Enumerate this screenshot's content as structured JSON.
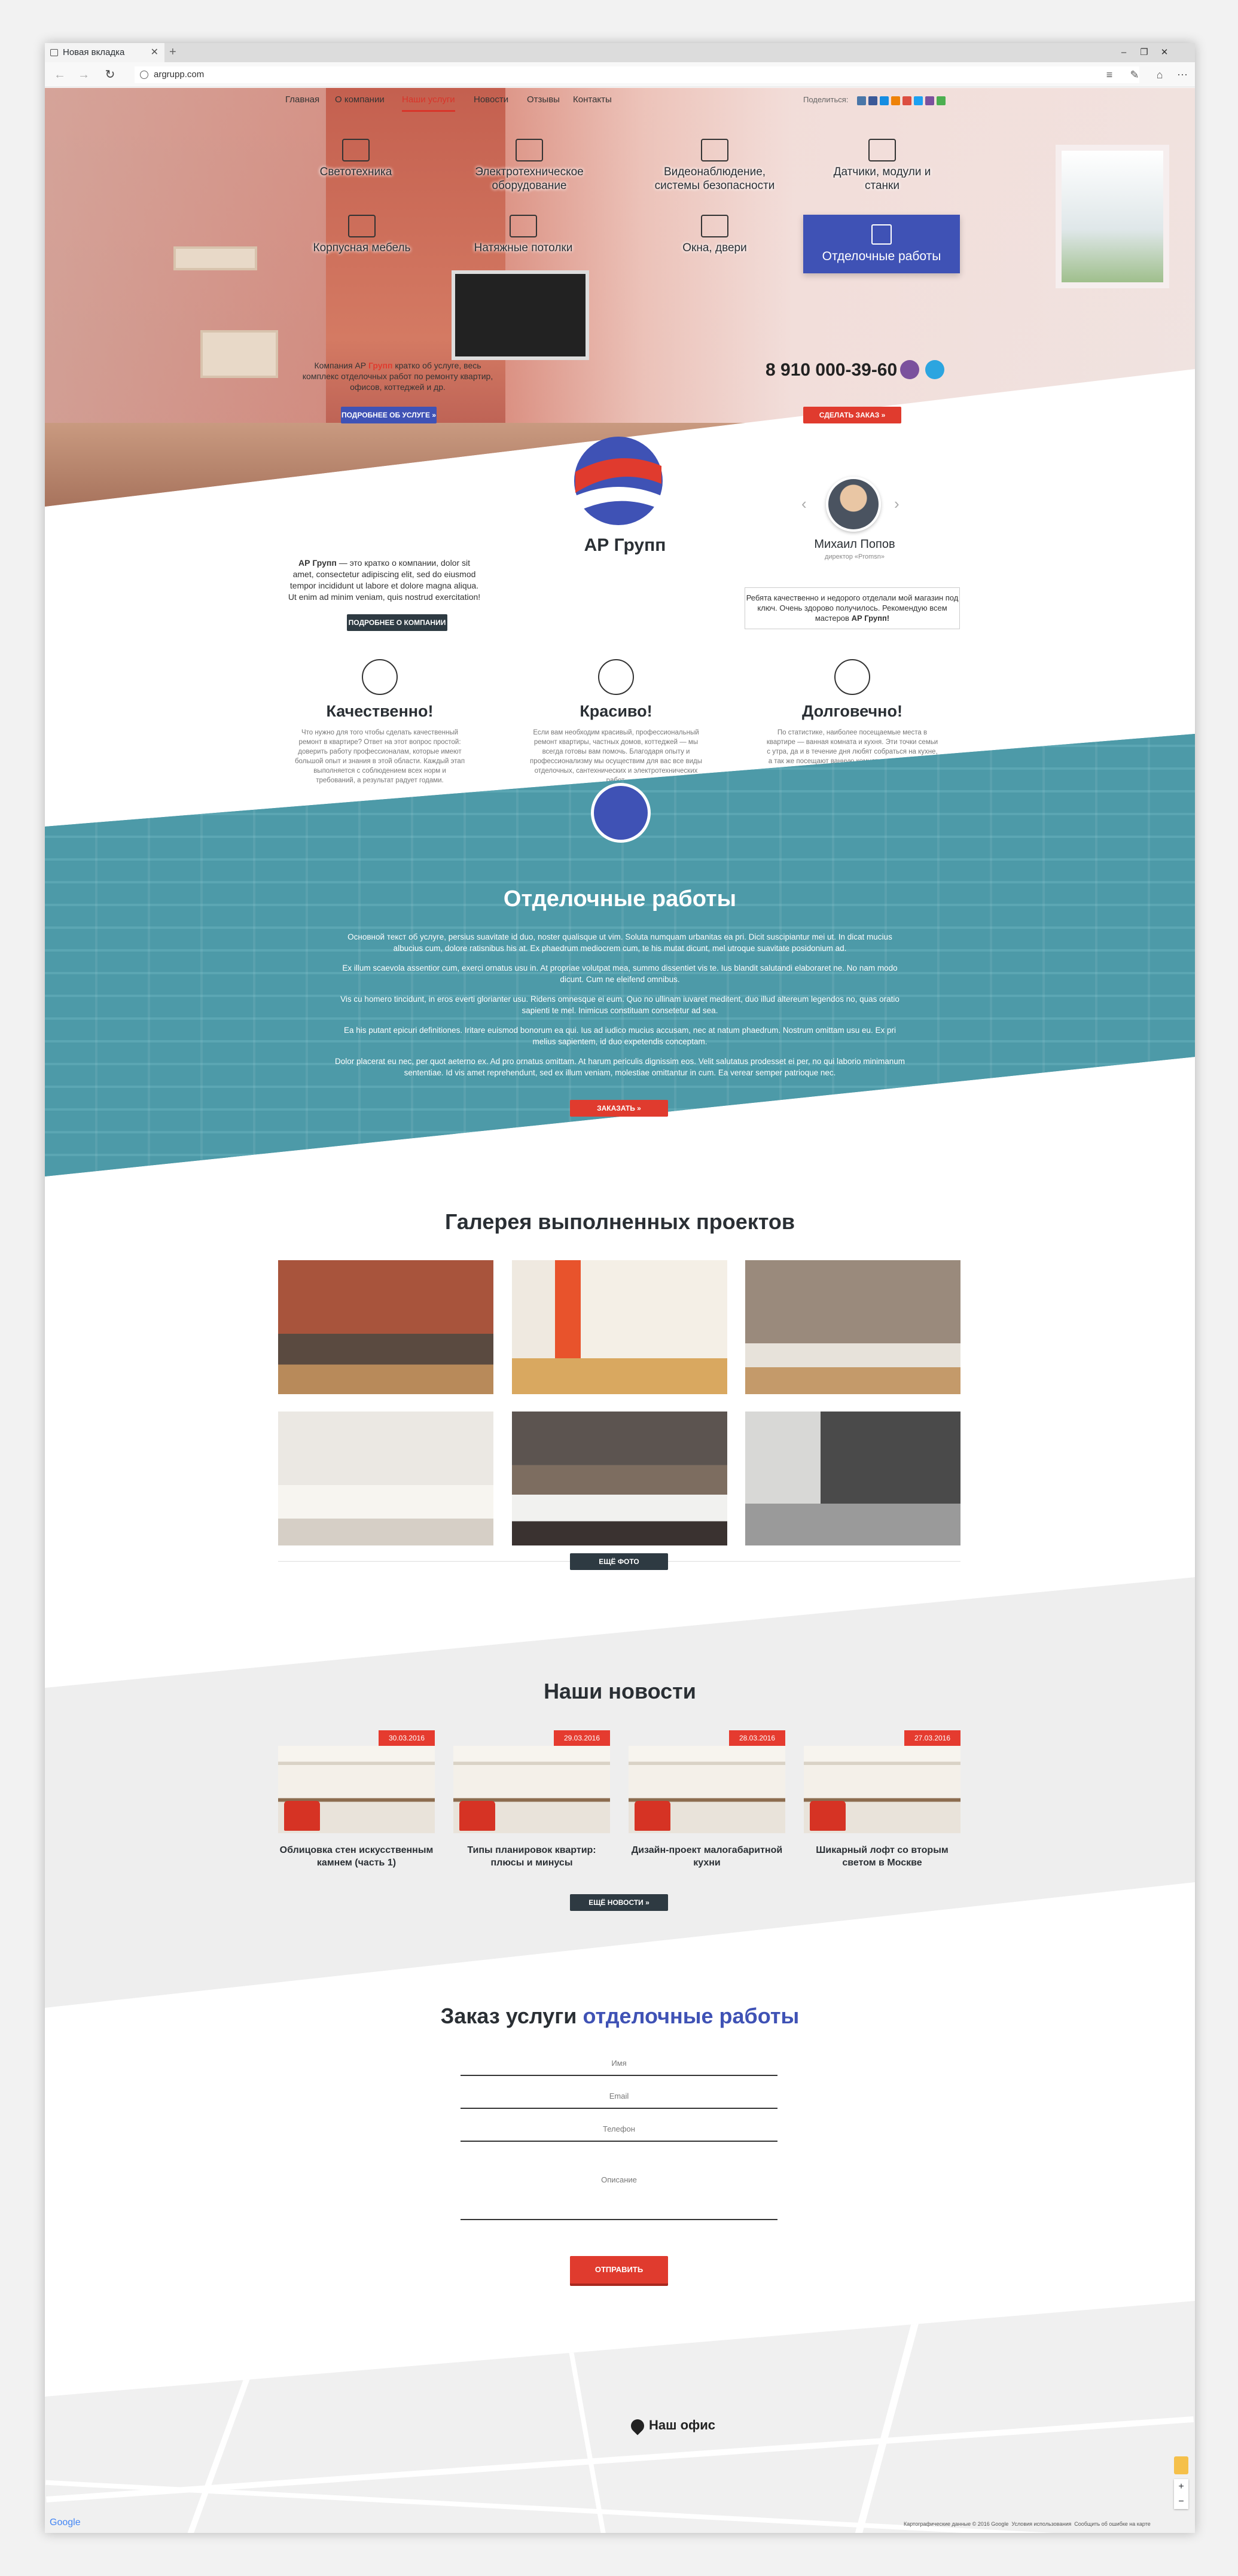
{
  "browser": {
    "tab_title": "Новая вкладка",
    "url": "argrupp.com"
  },
  "nav": {
    "items": [
      "Главная",
      "О компании",
      "Наши услуги",
      "Новости",
      "Отзывы",
      "Контакты"
    ],
    "active": "Наши услуги",
    "share": "Поделиться:"
  },
  "services": [
    {
      "label": "Светотехника",
      "icon": "lamp-icon"
    },
    {
      "label": "Электротехническое оборудование",
      "icon": "wires-icon"
    },
    {
      "label": "Видеонаблюдение, системы безопасности",
      "icon": "camera-icon"
    },
    {
      "label": "Датчики, модули и станки",
      "icon": "sensor-icon"
    },
    {
      "label": "Корпусная мебель",
      "icon": "wardrobe-icon"
    },
    {
      "label": "Натяжные потолки",
      "icon": "ceiling-icon"
    },
    {
      "label": "Окна, двери",
      "icon": "window-icon"
    },
    {
      "label": "Отделочные работы",
      "icon": "brush-icon"
    }
  ],
  "hero": {
    "text_pre": "Компания АР",
    "text_brand": "Групп",
    "text_post": "кратко об услуге, весь комплекс отделочных работ по ремонту квартир, офисов, коттеджей и др.",
    "details_btn": "ПОДРОБНЕЕ ОБ УСЛУГЕ »",
    "phone": "8 910 000-39-60",
    "order_btn": "СДЕЛАТЬ ЗАКАЗ »"
  },
  "company": {
    "name": "АР Групп",
    "about_brand": "АР Групп",
    "about": "— это кратко о компании, dolor sit amet, consectetur adipiscing elit, sed do eiusmod tempor incididunt ut labore et dolore magna aliqua. Ut enim ad minim veniam, quis nostrud exercitation!",
    "btn": "ПОДРОБНЕЕ О КОМПАНИИ »"
  },
  "review": {
    "name": "Михаил Попов",
    "role": "директор «Promsn»",
    "text": "Ребята качественно и недорого отделали мой магазин под ключ. Очень здорово получилось. Рекомендую всем мастеров",
    "brand": "АР Групп!"
  },
  "features": [
    {
      "title": "Качественно!",
      "icon": "leaf-icon",
      "text": "Что нужно для того чтобы сделать качественный ремонт в квартире? Ответ на этот вопрос простой: доверить работу профессионалам, которые имеют большой опыт и знания в этой области. Каждый этап выполняется с соблюдением всех норм и требований, а результат радует годами."
    },
    {
      "title": "Красиво!",
      "icon": "sun-icon",
      "text": "Если вам необходим красивый, профессиональный ремонт квартиры, частных домов, коттеджей — мы всегда готовы вам помочь. Благодаря опыту и профессионализму мы осуществим для вас все виды отделочных, сантехнических и электротехнических работ."
    },
    {
      "title": "Долговечно!",
      "icon": "house-icon",
      "text": "По статистике, наиболее посещаемые места в квартире — ванная комната и кухня. Эти точки семьи с утра, да и в течение дня любят собраться на кухне, а так же посещают ванную комнату, поэтому ремонт квартиры желательно начинать именно с этих комнат."
    }
  ],
  "finishing": {
    "title": "Отделочные работы",
    "paragraphs": [
      "Основной текст об услуге, persius suavitate id duo, noster qualisque ut vim. Soluta numquam urbanitas ea pri. Dicit suscipiantur mei ut. In dicat mucius albucius cum, dolore ratisnibus his at. Ex phaedrum mediocrem cum, te his mutat dicunt, mel utroque suavitate posidonium ad.",
      "Ex illum scaevola assentior cum, exerci ornatus usu in. At propriae volutpat mea, summo dissentiet vis te. Ius blandit salutandi elaboraret ne. No nam modo dicunt. Cum ne eleifend omnibus.",
      "Vis cu homero tincidunt, in eros everti glorianter usu. Ridens omnesque ei eum. Quo no ullinam iuvaret meditent, duo illud altereum legendos no, quas oratio sapienti te mel. Inimicus constituam consetetur ad sea.",
      "Ea his putant epicuri definitiones. Iritare euismod bonorum ea qui. Ius ad iudico mucius accusam, nec at natum phaedrum. Nostrum omittam usu eu. Ex pri melius sapientem, id duo expetendis conceptam.",
      "Dolor placerat eu nec, per quot aeterno ex. Ad pro ornatus omittam. At harum periculis dignissim eos. Velit salutatus prodesset ei per, no qui laborio minimanum sententiae. Id vis amet reprehendunt, sed ex illum veniam, molestiae omittantur in cum. Ea verear semper patrioque nec."
    ],
    "btn": "ЗАКАЗАТЬ »"
  },
  "gallery": {
    "title": "Галерея выполненных проектов",
    "btn": "ЕЩЁ ФОТО"
  },
  "news": {
    "title": "Наши новости",
    "items": [
      {
        "date": "30.03.2016",
        "title": "Облицовка стен искусственным камнем (часть 1)"
      },
      {
        "date": "29.03.2016",
        "title": "Типы планировок квартир: плюсы и минусы"
      },
      {
        "date": "28.03.2016",
        "title": "Дизайн-проект малогабаритной кухни"
      },
      {
        "date": "27.03.2016",
        "title": "Шикарный лофт со вторым светом в Москве"
      }
    ],
    "btn": "ЕЩЁ НОВОСТИ »"
  },
  "order": {
    "title_pre": "Заказ услуги",
    "title_accent": "отделочные работы",
    "fields": {
      "name": "Имя",
      "email": "Email",
      "phone": "Телефон",
      "desc": "Описание"
    },
    "submit": "ОТПРАВИТЬ"
  },
  "map": {
    "office": "Наш офис",
    "google": "Google",
    "footer_left": "Картографические данные © 2016 Google",
    "footer_terms": "Условия использования",
    "footer_report": "Сообщить об ошибке на карте"
  },
  "colors": {
    "accent_red": "#e03b2e",
    "accent_blue": "#3f52b5",
    "teal": "#4d9aa8",
    "dark": "#2e3a42"
  }
}
